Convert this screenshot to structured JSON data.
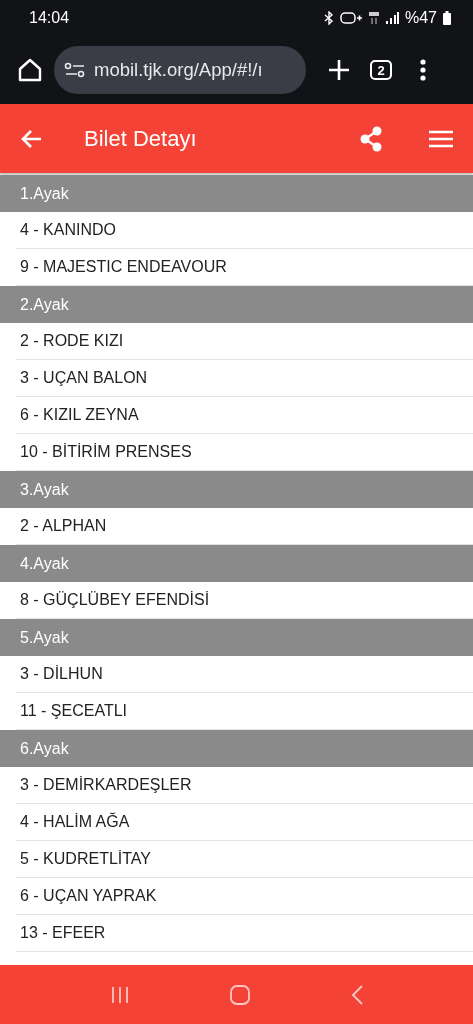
{
  "status_bar": {
    "time": "14:04",
    "battery": "%47"
  },
  "browser": {
    "url": "mobil.tjk.org/App/#!/ı",
    "tab_count": "2"
  },
  "header": {
    "title": "Bilet Detayı"
  },
  "legs": [
    {
      "title": "1.Ayak",
      "horses": [
        "4 - KANINDO",
        "9 - MAJESTIC ENDEAVOUR"
      ]
    },
    {
      "title": "2.Ayak",
      "horses": [
        "2 - RODE KIZI",
        "3 - UÇAN BALON",
        "6 - KIZIL ZEYNA",
        "10 - BİTİRİM PRENSES"
      ]
    },
    {
      "title": "3.Ayak",
      "horses": [
        "2 - ALPHAN"
      ]
    },
    {
      "title": "4.Ayak",
      "horses": [
        "8 - GÜÇLÜBEY EFENDİSİ"
      ]
    },
    {
      "title": "5.Ayak",
      "horses": [
        "3 - DİLHUN",
        "11 - ŞECEATLI"
      ]
    },
    {
      "title": "6.Ayak",
      "horses": [
        "3 - DEMİRKARDEŞLER",
        "4 - HALİM AĞA",
        "5 - KUDRETLİTAY",
        "6 - UÇAN YAPRAK",
        "13 - EFEER"
      ]
    }
  ]
}
